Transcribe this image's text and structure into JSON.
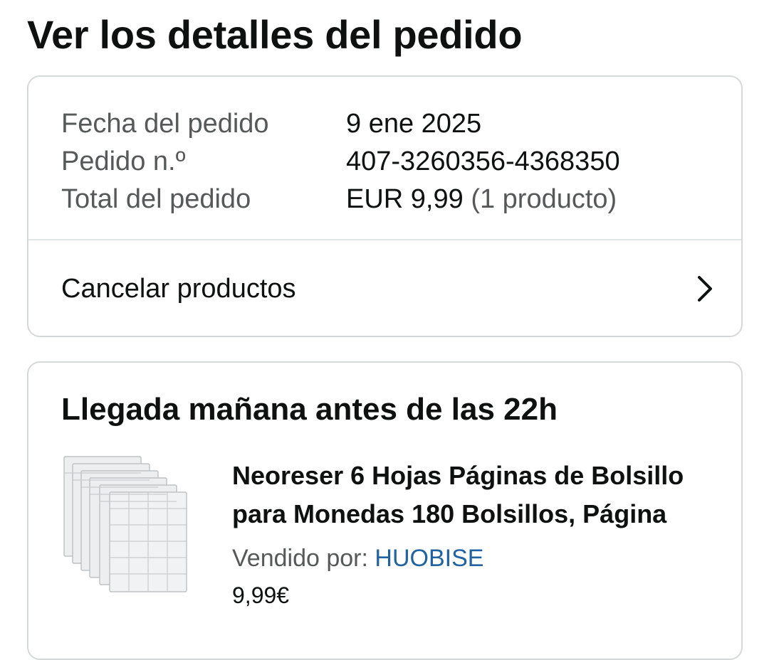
{
  "page": {
    "title": "Ver los detalles del pedido"
  },
  "summary": {
    "rows": [
      {
        "label": "Fecha del pedido",
        "value": "9 ene 2025"
      },
      {
        "label": "Pedido n.º",
        "value": "407-3260356-4368350"
      },
      {
        "label": "Total del pedido",
        "value": "EUR 9,99",
        "extra": "(1 producto)"
      }
    ],
    "cancel_label": "Cancelar productos",
    "cancel_icon": "chevron-right-icon"
  },
  "delivery": {
    "title": "Llegada mañana antes de las 22h",
    "product": {
      "title": "Neoreser 6 Hojas Páginas de Bolsillo para Monedas 180 Bolsillos, Página",
      "seller_prefix": "Vendido por:",
      "seller_name": "HUOBISE",
      "price": "9,99€",
      "image_icon": "coin-pages-product-image"
    }
  },
  "colors": {
    "text": "#0f1111",
    "muted": "#565959",
    "link": "#2162a1",
    "border": "#d5d9d9"
  }
}
